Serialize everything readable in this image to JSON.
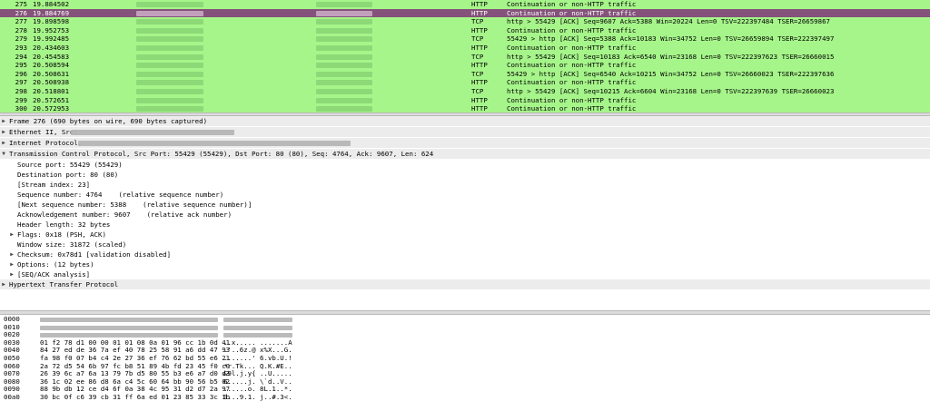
{
  "packets": [
    {
      "no": "275",
      "time": "19.884502",
      "proto": "HTTP",
      "info": "Continuation or non-HTTP traffic",
      "selected": false
    },
    {
      "no": "276",
      "time": "19.884769",
      "proto": "HTTP",
      "info": "Continuation or non-HTTP traffic",
      "selected": true
    },
    {
      "no": "277",
      "time": "19.898598",
      "proto": "TCP",
      "info": "http > 55429 [ACK] Seq=9607 Ack=5388 Win=20224 Len=0 TSV=222397484 TSER=26659867",
      "selected": false
    },
    {
      "no": "278",
      "time": "19.952753",
      "proto": "HTTP",
      "info": "Continuation or non-HTTP traffic",
      "selected": false
    },
    {
      "no": "279",
      "time": "19.992485",
      "proto": "TCP",
      "info": "55429 > http [ACK] Seq=5388 Ack=10183 Win=34752 Len=0 TSV=26659894 TSER=222397497",
      "selected": false
    },
    {
      "no": "293",
      "time": "20.434603",
      "proto": "HTTP",
      "info": "Continuation or non-HTTP traffic",
      "selected": false
    },
    {
      "no": "294",
      "time": "20.454583",
      "proto": "TCP",
      "info": "http > 55429 [ACK] Seq=10183 Ack=6540 Win=23168 Len=0 TSV=222397623 TSER=26660015",
      "selected": false
    },
    {
      "no": "295",
      "time": "20.508594",
      "proto": "HTTP",
      "info": "Continuation or non-HTTP traffic",
      "selected": false
    },
    {
      "no": "296",
      "time": "20.508631",
      "proto": "TCP",
      "info": "55429 > http [ACK] Seq=6540 Ack=10215 Win=34752 Len=0 TSV=26660023 TSER=222397636",
      "selected": false
    },
    {
      "no": "297",
      "time": "20.508938",
      "proto": "HTTP",
      "info": "Continuation or non-HTTP traffic",
      "selected": false
    },
    {
      "no": "298",
      "time": "20.518801",
      "proto": "TCP",
      "info": "http > 55429 [ACK] Seq=10215 Ack=6604 Win=23168 Len=0 TSV=222397639 TSER=26660023",
      "selected": false
    },
    {
      "no": "299",
      "time": "20.572651",
      "proto": "HTTP",
      "info": "Continuation or non-HTTP traffic",
      "selected": false
    },
    {
      "no": "300",
      "time": "20.572953",
      "proto": "HTTP",
      "info": "Continuation or non-HTTP traffic",
      "selected": false
    }
  ],
  "details": {
    "frame": "Frame 276 (690 bytes on wire, 690 bytes captured)",
    "ethernet": "Ethernet II, Src:",
    "ip": "Internet Protocol,",
    "tcp": "Transmission Control Protocol, Src Port: 55429 (55429), Dst Port: 80 (80), Seq: 4764, Ack: 9607, Len: 624",
    "tcp_fields": {
      "src_port": "Source port: 55429 (55429)",
      "dst_port": "Destination port: 80 (80)",
      "stream": "[Stream index: 23]",
      "seq": "Sequence number: 4764",
      "seq_note": "(relative sequence number)",
      "next_seq": "[Next sequence number: 5388",
      "next_seq_note": "(relative sequence number)]",
      "ack": "Acknowledgement number: 9607",
      "ack_note": "(relative ack number)",
      "hdr_len": "Header length: 32 bytes",
      "flags": "Flags: 0x18 (PSH, ACK)",
      "window": "Window size: 31872 (scaled)",
      "checksum": "Checksum: 0x78d1 [validation disabled]",
      "options": "Options: (12 bytes)",
      "seqack": "[SEQ/ACK analysis]"
    },
    "http": "Hypertext Transfer Protocol"
  },
  "hex_rows": [
    {
      "off": "0000",
      "bytes": "",
      "ascii": ""
    },
    {
      "off": "0010",
      "bytes": "",
      "ascii": ""
    },
    {
      "off": "0020",
      "bytes": "",
      "ascii": ""
    },
    {
      "off": "0030",
      "bytes": "01 f2 78 d1 00 00 01 01  08 0a 01 96 cc 1b 0d 41",
      "ascii": "..x..... .......A"
    },
    {
      "off": "0040",
      "bytes": "84 27 ed de 36 7a ef 40  78 25 58 91 a6 dd 47 93",
      "ascii": ".'..6z.@ x%X...G."
    },
    {
      "off": "0050",
      "bytes": "fa 98 f0 07 b4 c4 2e 27  36 ef 76 62 bd 55 e6 21",
      "ascii": ".......' 6.vb.U.!"
    },
    {
      "off": "0060",
      "bytes": "2a 72 d5 54 6b 97 fc b8  51 89 4b fd 23 45 f0 c0",
      "ascii": "*r.Tk... Q.K.#E.."
    },
    {
      "off": "0070",
      "bytes": "26 39 6c a7 6a 13 79 7b  d5 80 55 b3 e6 a7 d0 d3",
      "ascii": "&9l.j.y{ ..U....."
    },
    {
      "off": "0080",
      "bytes": "36 1c 02 ee 86 d8 6a c4  5c 60 64 bb 90 56 b5 02",
      "ascii": "6.....j. \\`d..V.."
    },
    {
      "off": "0090",
      "bytes": "88 9b db 12 ce d4 6f 0a  38 4c 95 31 d2 d7 2a 97",
      "ascii": "......o. 8L.1..*."
    },
    {
      "off": "00a0",
      "bytes": "30 bc 0f c6 39 cb 31 ff  6a ed 01 23 85 33 3c 1b",
      "ascii": "0...9.1. j..#.3<."
    }
  ]
}
